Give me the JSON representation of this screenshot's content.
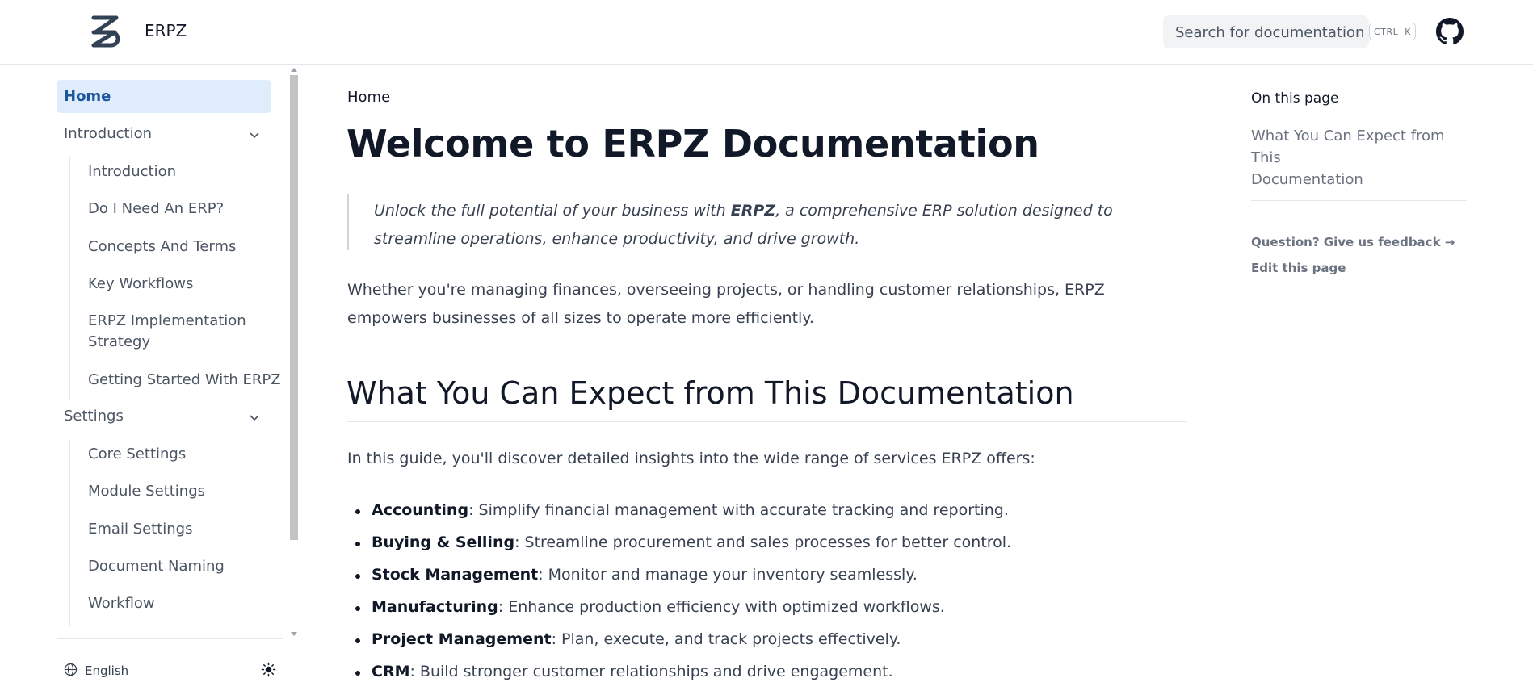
{
  "header": {
    "brand": "ERPZ",
    "search_placeholder": "Search for documentation",
    "shortcut_ctrl": "CTRL",
    "shortcut_key": "K"
  },
  "sidebar": {
    "active": "Home",
    "groups": [
      {
        "label": "Introduction",
        "items": [
          "Introduction",
          "Do I Need An ERP?",
          "Concepts And Terms",
          "Key Workflows",
          "ERPZ Implementation",
          "Strategy",
          "Getting Started With ERPZ"
        ]
      },
      {
        "label": "Settings",
        "items": [
          "Core Settings",
          "Module Settings",
          "Email Settings",
          "Document Naming",
          "Workflow"
        ]
      }
    ],
    "footer": {
      "language": "English"
    }
  },
  "main": {
    "breadcrumb": "Home",
    "title": "Welcome to ERPZ Documentation",
    "quote_pre": "Unlock the full potential of your business with ",
    "quote_brand": "ERPZ",
    "quote_post": ", a comprehensive ERP solution designed to streamline operations, enhance productivity, and drive growth.",
    "paragraph": "Whether you're managing finances, overseeing projects, or handling customer relationships, ERPZ empowers businesses of all sizes to operate more efficiently.",
    "section_title": "What You Can Expect from This Documentation",
    "section_intro": "In this guide, you'll discover detailed insights into the wide range of services ERPZ offers:",
    "features": [
      {
        "name": "Accounting",
        "desc": ": Simplify financial management with accurate tracking and reporting."
      },
      {
        "name": "Buying & Selling",
        "desc": ": Streamline procurement and sales processes for better control."
      },
      {
        "name": "Stock Management",
        "desc": ": Monitor and manage your inventory seamlessly."
      },
      {
        "name": "Manufacturing",
        "desc": ": Enhance production efficiency with optimized workflows."
      },
      {
        "name": "Project Management",
        "desc": ": Plan, execute, and track projects effectively."
      },
      {
        "name": "CRM",
        "desc": ": Build stronger customer relationships and drive engagement."
      }
    ]
  },
  "toc": {
    "title": "On this page",
    "link_line1": "What You Can Expect from This",
    "link_line2": "Documentation",
    "feedback": "Question? Give us feedback →",
    "edit": "Edit this page"
  },
  "colors": {
    "accent": "#1e56a0",
    "active_bg": "#deecfb",
    "text": "#374151",
    "heading": "#111827"
  }
}
